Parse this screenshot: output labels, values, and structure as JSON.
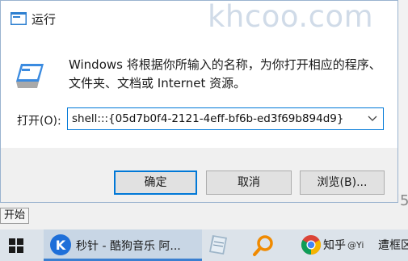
{
  "dialog": {
    "title": "运行",
    "watermark": "khcoo.com",
    "description": "Windows 将根据你所输入的名称，为你打开相应的程序、文件夹、文档或 Internet 资源。",
    "open_label": "打开(O):",
    "open_value": "shell:::{05d7b0f4-2121-4eff-bf6b-ed3f69b894d9}",
    "buttons": {
      "ok": "确定",
      "cancel": "取消",
      "browse": "浏览(B)..."
    }
  },
  "tooltip": "开始",
  "taskbar": {
    "app_label": "秒针 - 酷狗音乐 阿...",
    "chrome_label": "知乎",
    "chrome_sub": "@Yi",
    "extra_label": "遭框区"
  },
  "desktop_digit": "5"
}
